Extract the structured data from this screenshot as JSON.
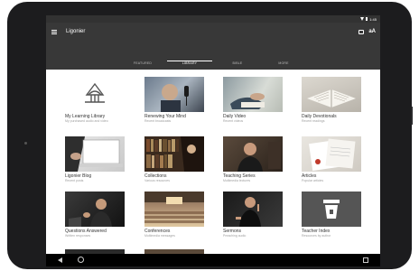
{
  "status": {
    "time": "1:45"
  },
  "appbar": {
    "title": "Ligonier"
  },
  "tabs": [
    {
      "label": "FEATURED"
    },
    {
      "label": "LIBRARY"
    },
    {
      "label": "BIBLE"
    },
    {
      "label": "MORE"
    }
  ],
  "active_tab": "LIBRARY",
  "cards": [
    {
      "title": "My Learning Library",
      "subtitle": "My purchased audio and video",
      "icon": "ligonier-logo-icon"
    },
    {
      "title": "Renewing Your Mind",
      "subtitle": "Recent broadcasts",
      "icon": "microphone-photo"
    },
    {
      "title": "Daily Video",
      "subtitle": "Recent videos",
      "icon": "hands-bible-photo"
    },
    {
      "title": "Daily Devotionals",
      "subtitle": "Recent readings",
      "icon": "open-book-photo"
    },
    {
      "title": "Ligonier Blog",
      "subtitle": "Recent posts",
      "icon": "laptop-photo"
    },
    {
      "title": "Collections",
      "subtitle": "Various resources",
      "icon": "bookshelf-photo"
    },
    {
      "title": "Teaching Series",
      "subtitle": "Multimedia lectures",
      "icon": "teacher-photo"
    },
    {
      "title": "Articles",
      "subtitle": "Popular articles",
      "icon": "documents-photo"
    },
    {
      "title": "Questions Answered",
      "subtitle": "Written responses",
      "icon": "speaker-photo"
    },
    {
      "title": "Conferences",
      "subtitle": "Multimedia messages",
      "icon": "conference-hall-photo"
    },
    {
      "title": "Sermons",
      "subtitle": "Preaching audio",
      "icon": "preacher-photo"
    },
    {
      "title": "Teacher Index",
      "subtitle": "Resources by author",
      "icon": "podium-icon"
    }
  ]
}
